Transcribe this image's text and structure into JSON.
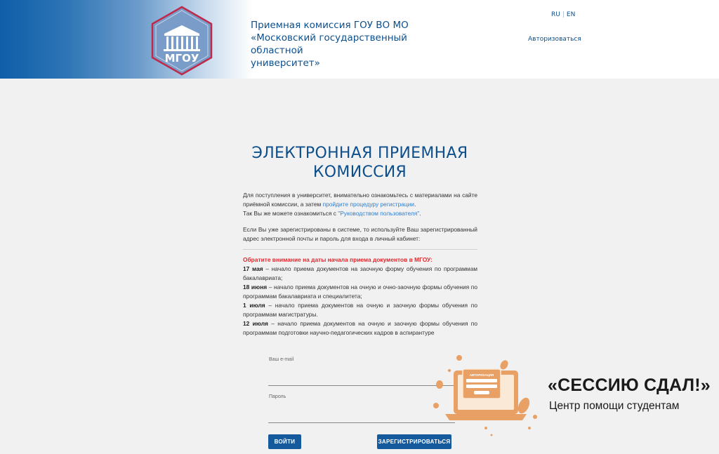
{
  "header": {
    "logo_text": "МГОУ",
    "title_lines": [
      "Приемная комиссия ГОУ ВО МО",
      "«Московский государственный областной",
      "университет»"
    ],
    "lang_ru": "RU",
    "lang_en": "EN",
    "login_link": "Авторизоваться"
  },
  "main": {
    "title_line1": "ЭЛЕКТРОННАЯ ПРИЕМНАЯ",
    "title_line2": "КОМИССИЯ",
    "intro_1": "Для поступления в университет, внимательно ознакомьтесь с материалами на сайте приёмной комиссии, а затем ",
    "register_link": "пройдите процедуру регистрации",
    "intro_1_end": ".",
    "intro_2": "Так Вы же можете ознакомиться с ",
    "guide_link": "\"Руководством пользователя\"",
    "intro_2_end": ".",
    "registered_text": "Если Вы уже зарегистрированы в системе, то используйте Ваш зарегистрированный адрес электронной почты и пароль для входа в личный кабинет:",
    "notice_title": "Обратите внимание на даты начала приема документов в МГОУ:",
    "dates": [
      {
        "date": "17 мая",
        "text": " – начало приема документов на заочную форму обучения по программам бакалавриата;"
      },
      {
        "date": "18 июня",
        "text": " – начало приема документов на очную и очно-заочную формы обучения по программам бакалавриата и специалитета;"
      },
      {
        "date": "1 июля",
        "text": " – начало приема документов на очную и заочную формы обучения по программам магистратуры."
      },
      {
        "date": "12 июля",
        "text": " – начало приема документов на очную и заочную формы обучения по программам подготовки научно-педагогических кадров в аспирантуре"
      }
    ]
  },
  "form": {
    "email_label": "Ваш e-mail",
    "email_value": "",
    "password_label": "Пароль",
    "password_value": "",
    "login_button": "ВОЙТИ",
    "register_button": "ЗАРЕГИСТРИРОВАТЬСЯ"
  },
  "watermark": {
    "screen_title": "АВТОРИЗАЦИЯ",
    "title": "«СЕССИЮ СДАЛ!»",
    "subtitle": "Центр помощи студентам",
    "accent_color": "#e8a064"
  }
}
